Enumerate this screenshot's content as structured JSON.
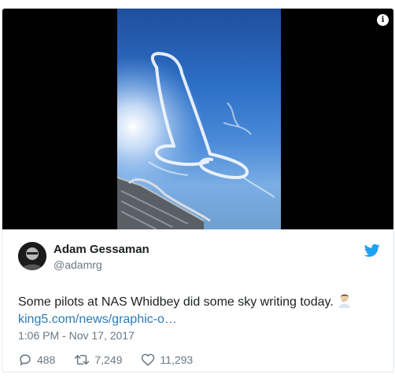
{
  "colors": {
    "link": "#2b7bb9",
    "text": "#1c2022",
    "muted": "#697882",
    "twitter_blue": "#1da1f2",
    "border": "#e1e8ed"
  },
  "media": {
    "info_icon": "i"
  },
  "author": {
    "name": "Adam Gessaman",
    "handle": "@adamrg"
  },
  "tweet": {
    "text": "Some pilots at NAS Whidbey did some sky writing today.",
    "emoji": "person-facepalming-emoji",
    "link": "king5.com/news/graphic-o…",
    "timestamp": "1:06 PM - Nov 17, 2017"
  },
  "actions": {
    "replies": "488",
    "retweets": "7,249",
    "likes": "11,293"
  },
  "icons": {
    "bird": "twitter-bird-icon",
    "info": "info-icon",
    "reply": "reply-icon",
    "retweet": "retweet-icon",
    "like": "heart-icon"
  }
}
